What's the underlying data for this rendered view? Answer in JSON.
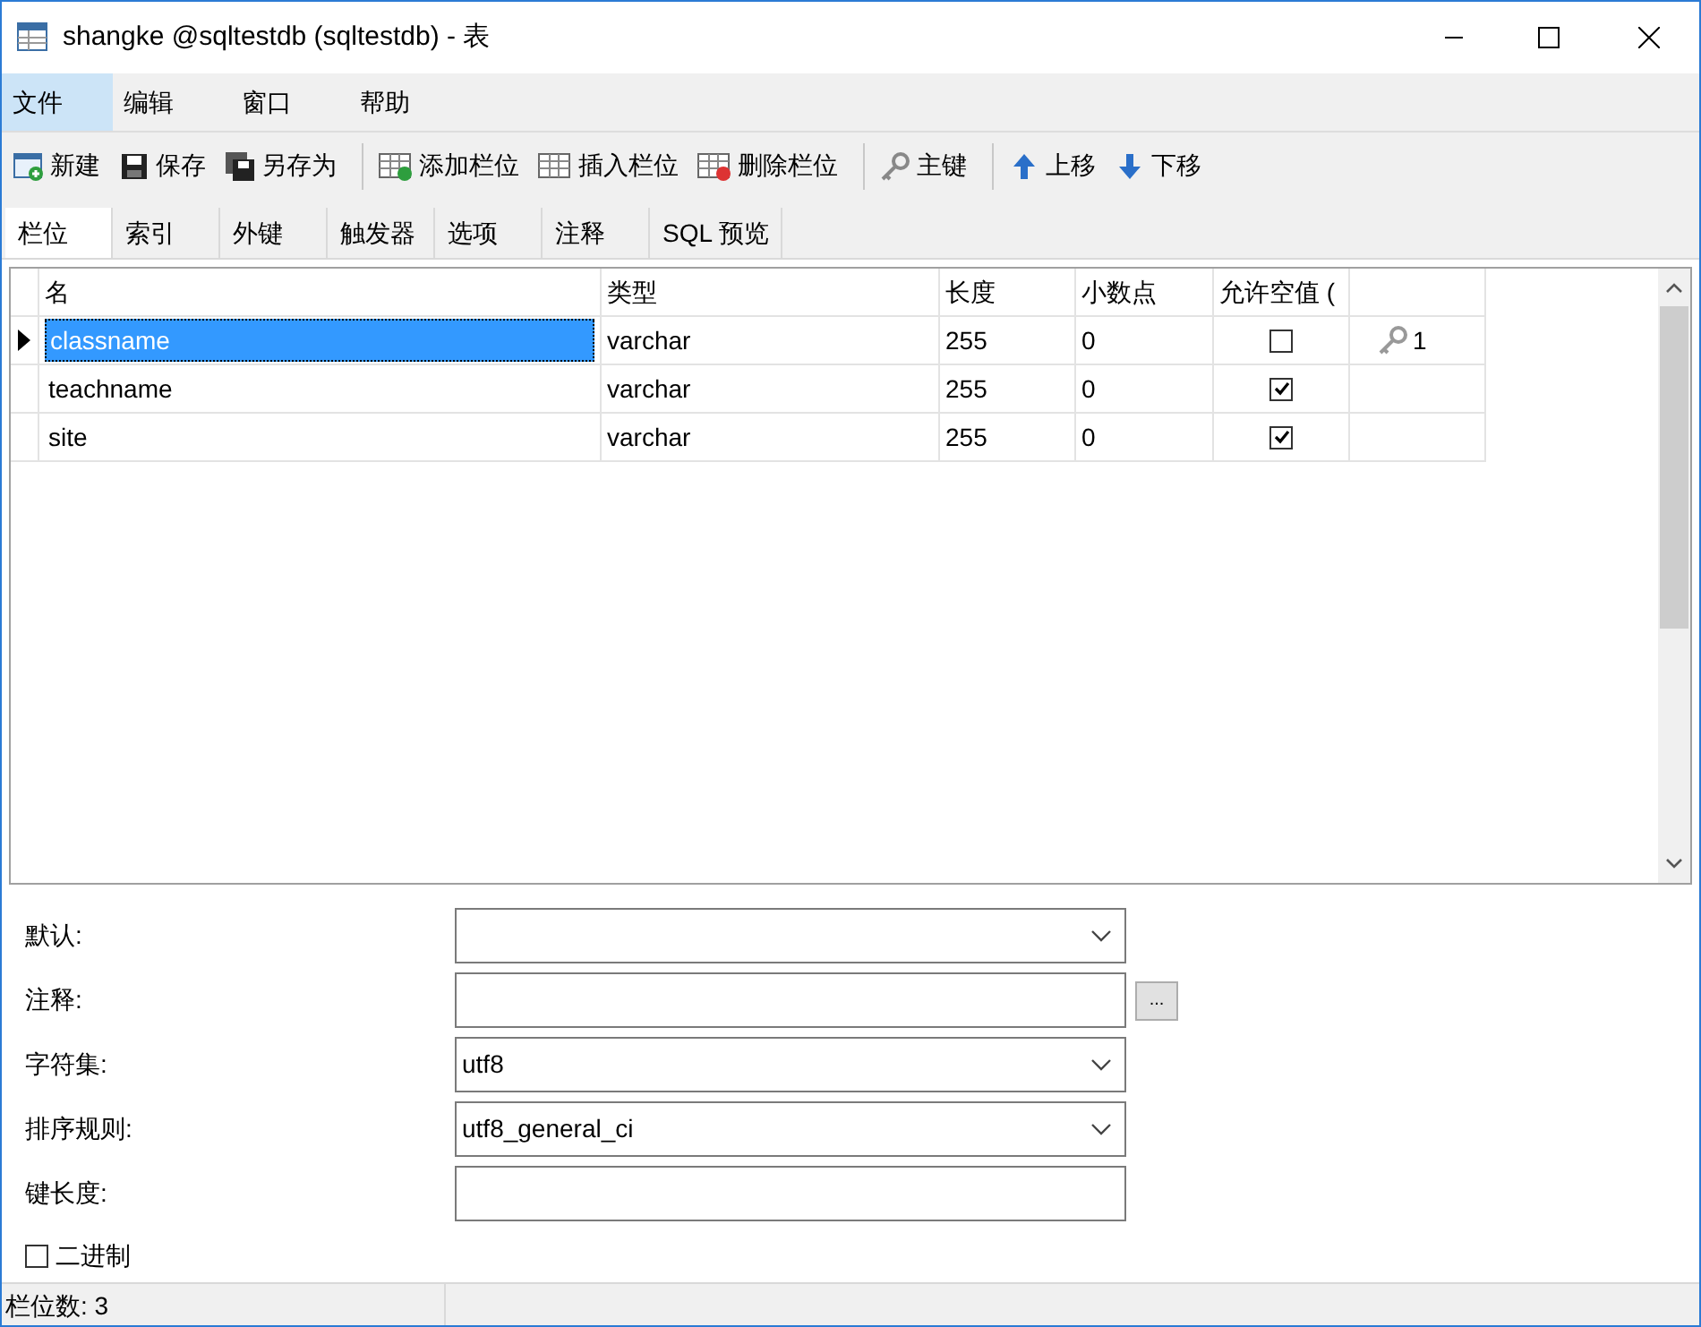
{
  "window": {
    "title": "shangke @sqltestdb (sqltestdb) - 表"
  },
  "menu": [
    {
      "label": "文件",
      "selected": true
    },
    {
      "label": "编辑",
      "selected": false
    },
    {
      "label": "窗口",
      "selected": false
    },
    {
      "label": "帮助",
      "selected": false
    }
  ],
  "toolbar": [
    [
      {
        "kind": "new",
        "label": "新建"
      },
      {
        "kind": "save",
        "label": "保存"
      },
      {
        "kind": "saveas",
        "label": "另存为"
      }
    ],
    [
      {
        "kind": "add",
        "label": "添加栏位"
      },
      {
        "kind": "insert",
        "label": "插入栏位"
      },
      {
        "kind": "delete",
        "label": "删除栏位"
      }
    ],
    [
      {
        "kind": "key",
        "label": "主键"
      }
    ],
    [
      {
        "kind": "up",
        "label": "上移"
      },
      {
        "kind": "down",
        "label": "下移"
      }
    ]
  ],
  "tabs": [
    {
      "label": "栏位",
      "selected": true
    },
    {
      "label": "索引",
      "selected": false
    },
    {
      "label": "外键",
      "selected": false
    },
    {
      "label": "触发器",
      "selected": false
    },
    {
      "label": "选项",
      "selected": false
    },
    {
      "label": "注释",
      "selected": false
    },
    {
      "label": "SQL 预览",
      "selected": false
    }
  ],
  "table": {
    "columns": [
      "名",
      "类型",
      "长度",
      "小数点",
      "允许空值 ("
    ],
    "rows": [
      {
        "name": "classname",
        "type": "varchar",
        "length": "255",
        "decimals": "0",
        "allow_null": false,
        "key": "1",
        "selected": true
      },
      {
        "name": "teachname",
        "type": "varchar",
        "length": "255",
        "decimals": "0",
        "allow_null": true,
        "selected": false
      },
      {
        "name": "site",
        "type": "varchar",
        "length": "255",
        "decimals": "0",
        "allow_null": true,
        "selected": false
      }
    ]
  },
  "properties": [
    {
      "kind": "dropdown",
      "label": "默认:"
    },
    {
      "kind": "text_button",
      "label": "注释:",
      "button": "..."
    },
    {
      "kind": "dropdown",
      "label": "字符集:",
      "value": "utf8"
    },
    {
      "kind": "dropdown",
      "label": "排序规则:",
      "value": "utf8_general_ci"
    },
    {
      "kind": "text",
      "label": "键长度:"
    }
  ],
  "binary": {
    "label": "二进制",
    "checked": false
  },
  "status_bar": {
    "text": "栏位数: 3"
  }
}
